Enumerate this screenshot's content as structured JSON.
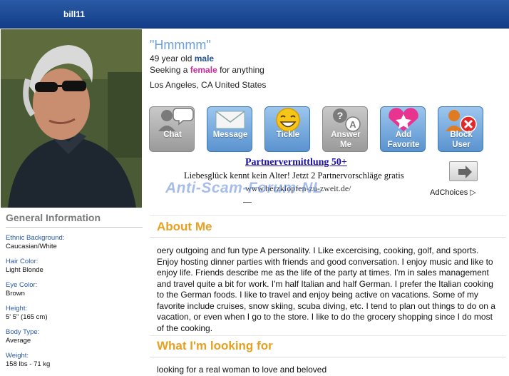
{
  "header": {
    "username": "bill11"
  },
  "profile": {
    "headline": "\"Hmmmm\"",
    "age_prefix": "49 year old",
    "gender": "male",
    "seeking_prefix": "Seeking a",
    "seeking_gender": "female",
    "seeking_suffix": "for anything",
    "location": "Los Angeles, CA United States"
  },
  "actions": [
    {
      "label": "Chat",
      "icon": "chat-bubble-icon",
      "enabled": false
    },
    {
      "label": "Message",
      "icon": "envelope-icon",
      "enabled": true
    },
    {
      "label": "Tickle",
      "icon": "smiley-icon",
      "enabled": true
    },
    {
      "label": "Answer\nMe",
      "icon": "question-answer-icon",
      "enabled": false
    },
    {
      "label": "Add\nFavorite",
      "icon": "heart-star-icon",
      "enabled": true
    },
    {
      "label": "Block\nUser",
      "icon": "block-user-icon",
      "enabled": true
    }
  ],
  "ad": {
    "title": "Partnervermittlung 50+",
    "text": "Liebesglück kennt kein Alter! Jetzt 2 Partnervorschläge gratis",
    "url": "www.herzklopfen-zu-zweit.de/",
    "adchoices": "AdChoices"
  },
  "watermark": "Anti-Scam-Forum-NL",
  "general_info": {
    "title": "General Information",
    "items": [
      {
        "label": "Ethnic Background:",
        "value": "Caucasian/White"
      },
      {
        "label": "Hair Color:",
        "value": "Light Blonde"
      },
      {
        "label": "Eye Color:",
        "value": "Brown"
      },
      {
        "label": "Height:",
        "value": "5' 5\" (165 cm)"
      },
      {
        "label": "Body Type:",
        "value": "Average"
      },
      {
        "label": "Weight:",
        "value": "158 lbs - 71 kg"
      }
    ]
  },
  "about": {
    "heading": "About Me",
    "text": "oery outgoing and fun type A personality. I Like excercising, cooking, golf, and sports. Enjoy hosting dinner parties with friends and good conversation. I enjoy music and like to enjoy life. Friends describe me as the life of the party at times. I'm in sales management and travel quite a bit for work. I'm half Italian and half German. I prefer the Italian cooking to the German foods. I like to travel and enjoy being active on vacations. Some of my favorite include cruises, snow skiing, scuba diving, etc. I tend to plan out things to do on a vacation, or even when I go to the store. I like to do the grocery shopping since I do most of the cooking."
  },
  "looking": {
    "heading": "What I'm looking for",
    "text": "looking for a real woman to love and beloved"
  },
  "colors": {
    "header": "#1f4f9a",
    "accent_orange": "#e9a020",
    "button_blue": "#6fa1d6",
    "female_pink": "#cc2a9c"
  }
}
